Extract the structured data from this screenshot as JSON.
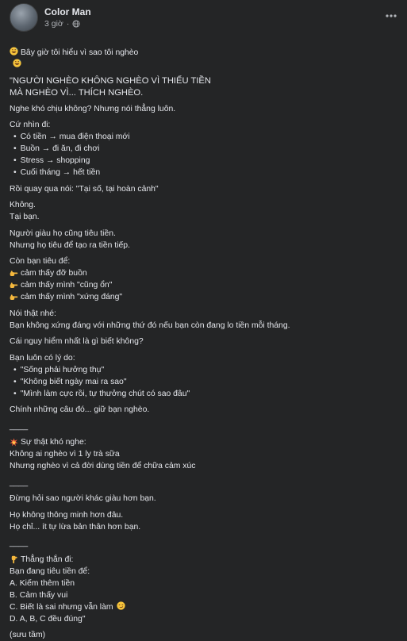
{
  "post": {
    "author": "Color Man",
    "time": "3 giờ",
    "title": "Bây giờ tôi hiểu vì sao tôi nghèo",
    "paragraphs": {
      "p1": "\"NGƯỜI NGHÈO KHÔNG NGHÈO VÌ THIẾU TIỀN\nMÀ NGHÈO VÌ... THÍCH NGHÈO.",
      "p2": "Nghe khó chịu không? Nhưng nói thẳng luôn.",
      "p3": "Cứ nhìn đi:",
      "list1": [
        "Có tiền → mua điện thoại mới",
        "Buồn → đi ăn, đi chơi",
        "Stress → shopping",
        "Cuối tháng → hết tiền"
      ],
      "p4": "Rồi quay qua nói: \"Tại số, tại hoàn cảnh\"",
      "p5": "Không.\nTại bạn.",
      "p6": "Người giàu họ cũng tiêu tiền.\nNhưng họ tiêu để tạo ra tiền tiếp.",
      "p7": "Còn bạn tiêu để:",
      "list2": [
        "cảm thấy đỡ buồn",
        "cảm thấy mình \"cũng ổn\"",
        "cảm thấy mình \"xứng đáng\""
      ],
      "p8": "Nói thật nhé:\nBạn không xứng đáng với những thứ đó nếu bạn còn đang lo tiền mỗi tháng.",
      "p9": "Cái nguy hiểm nhất là gì biết không?",
      "p10": "Bạn luôn có lý do:",
      "list3": [
        "\"Sống phải hưởng thụ\"",
        "\"Không biết ngày mai ra sao\"",
        "\"Mình làm cực rồi, tự thưởng chút có sao đâu\""
      ],
      "p11": "Chính những câu đó... giữ bạn nghèo.",
      "sep": "____",
      "p12_title": "Sự thật khó nghe:",
      "p12": "Không ai nghèo vì 1 ly trà sữa\nNhưng nghèo vì cả đời dùng tiền để chữa cảm xúc",
      "p13": "Đừng hỏi sao người khác giàu hơn bạn.",
      "p14": "Họ không thông minh hơn đâu.\nHọ chỉ... ít tự lừa bản thân hơn bạn.",
      "p15_title": "Thẳng thắn đi:",
      "p15": "Bạn đang tiêu tiền để:\nA. Kiếm thêm tiền\nB. Cảm thấy vui\nC. Biết là sai nhưng vẫn làm",
      "p15_last": "D. A, B, C đều đúng\"",
      "p16": "(sưu tầm)"
    }
  },
  "icons": {
    "more": "more-horizontal-icon",
    "globe": "globe-icon",
    "grin": "grinning-sweat-emoji",
    "point": "backhand-index-pointing-right-emoji",
    "point_down": "backhand-index-pointing-down-emoji",
    "collision": "collision-emoji",
    "smirk": "smirking-face-emoji"
  },
  "colors": {
    "background": "#242526",
    "text": "#e4e6eb",
    "secondary": "#b0b3b8"
  }
}
